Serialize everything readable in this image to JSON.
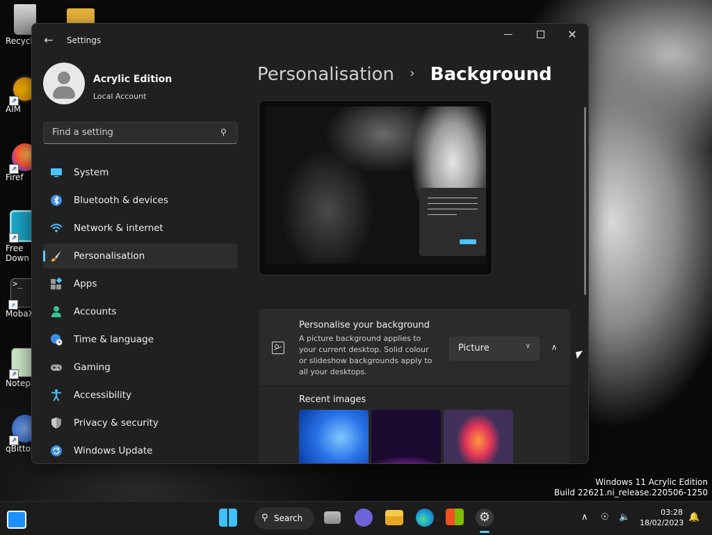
{
  "desktop": {
    "icons": [
      {
        "label": "Recycl",
        "name": "recycle-bin"
      },
      {
        "label": "AIM",
        "name": "aimp"
      },
      {
        "label": "Firef",
        "name": "firefox"
      },
      {
        "label": "Free Down",
        "name": "free-download-manager"
      },
      {
        "label": "MobaX",
        "name": "mobaxterm"
      },
      {
        "label": "Notepa",
        "name": "notepad"
      },
      {
        "label": "qBitto",
        "name": "qbittorrent"
      }
    ],
    "watermark_line1": "Windows 11 Acrylic Edition",
    "watermark_line2": "Build 22621.ni_release.220506-1250"
  },
  "window": {
    "title": "Settings",
    "profile": {
      "name": "Acrylic Edition",
      "account_type": "Local Account"
    },
    "search_placeholder": "Find a setting",
    "nav": [
      {
        "label": "System",
        "icon": "monitor-icon"
      },
      {
        "label": "Bluetooth & devices",
        "icon": "bluetooth-icon"
      },
      {
        "label": "Network & internet",
        "icon": "wifi-icon"
      },
      {
        "label": "Personalisation",
        "icon": "brush-icon",
        "active": true
      },
      {
        "label": "Apps",
        "icon": "apps-icon"
      },
      {
        "label": "Accounts",
        "icon": "person-icon"
      },
      {
        "label": "Time & language",
        "icon": "globe-clock-icon"
      },
      {
        "label": "Gaming",
        "icon": "gamepad-icon"
      },
      {
        "label": "Accessibility",
        "icon": "accessibility-icon"
      },
      {
        "label": "Privacy & security",
        "icon": "shield-icon"
      },
      {
        "label": "Windows Update",
        "icon": "update-icon"
      }
    ],
    "breadcrumb": {
      "parent": "Personalisation",
      "separator": "›",
      "current": "Background"
    },
    "background_card": {
      "title": "Personalise your background",
      "description": "A picture background applies to your current desktop. Solid colour or slideshow backgrounds apply to all your desktops.",
      "dropdown_value": "Picture"
    },
    "recent_images_label": "Recent images"
  },
  "taskbar": {
    "search_label": "Search",
    "time": "03:28",
    "date": "18/02/2023"
  },
  "colors": {
    "accent": "#60cdff",
    "window_bg": "#202020",
    "card_bg": "#2b2b2b"
  }
}
